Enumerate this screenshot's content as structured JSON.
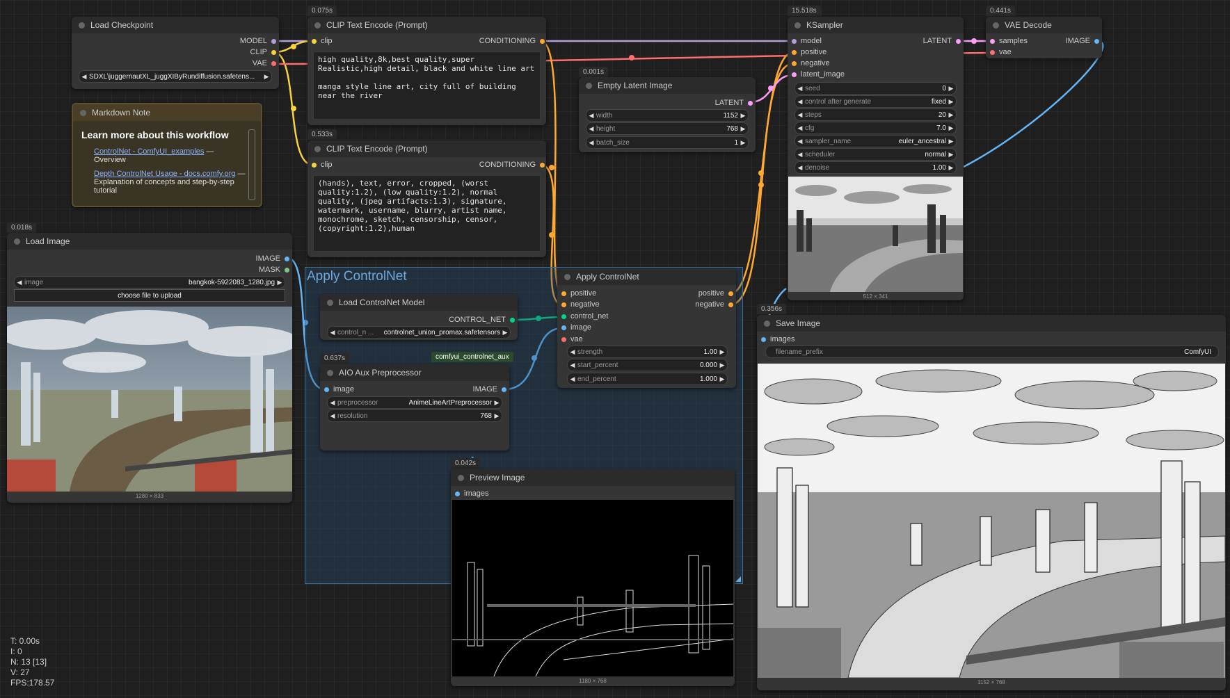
{
  "colors": {
    "model": "#b39ddb",
    "clip": "#f8d33f",
    "vae": "#ff6e6e",
    "conditioning": "#ffa931",
    "latent": "#ff9cf9",
    "image": "#64b5f6",
    "mask": "#81c784",
    "control_net": "#00d78d"
  },
  "load_checkpoint": {
    "title": "Load Checkpoint",
    "outputs": [
      "MODEL",
      "CLIP",
      "VAE"
    ],
    "ckpt_value": "SDXL\\juggernautXL_juggXIByRundiffusion.safetens..."
  },
  "markdown_note": {
    "title": "Markdown Note",
    "heading": "Learn more about this workflow",
    "item1_link": "ControlNet - ComfyUI_examples",
    "item1_rest": " — Overview",
    "item2_link": "Depth ControlNet Usage - docs.comfy.org",
    "item2_rest": " — Explanation of concepts and step-by-step tutorial"
  },
  "clip_pos": {
    "timing": "0.075s",
    "title": "CLIP Text Encode (Prompt)",
    "input": "clip",
    "output": "CONDITIONING",
    "text": "high quality,8k,best quality,super Realistic,high detail, black and white line art\n\nmanga style line art, city full of building near the river"
  },
  "clip_neg": {
    "timing": "0.533s",
    "title": "CLIP Text Encode (Prompt)",
    "input": "clip",
    "output": "CONDITIONING",
    "text": "(hands), text, error, cropped, (worst quality:1.2), (low quality:1.2), normal quality, (jpeg artifacts:1.3), signature, watermark, username, blurry, artist name, monochrome, sketch, censorship, censor, (copyright:1.2),human"
  },
  "empty_latent": {
    "timing": "0.001s",
    "title": "Empty Latent Image",
    "output": "LATENT",
    "widgets": [
      {
        "label": "width",
        "value": "1152"
      },
      {
        "label": "height",
        "value": "768"
      },
      {
        "label": "batch_size",
        "value": "1"
      }
    ]
  },
  "ksampler": {
    "timing": "15.518s",
    "title": "KSampler",
    "inputs": [
      "model",
      "positive",
      "negative",
      "latent_image"
    ],
    "output": "LATENT",
    "widgets": [
      {
        "label": "seed",
        "value": "0"
      },
      {
        "label": "control after generate",
        "value": "fixed"
      },
      {
        "label": "steps",
        "value": "20"
      },
      {
        "label": "cfg",
        "value": "7.0"
      },
      {
        "label": "sampler_name",
        "value": "euler_ancestral"
      },
      {
        "label": "scheduler",
        "value": "normal"
      },
      {
        "label": "denoise",
        "value": "1.00"
      }
    ],
    "preview_size": "512 × 341"
  },
  "vae_decode": {
    "timing": "0.441s",
    "title": "VAE Decode",
    "inputs": [
      "samples",
      "vae"
    ],
    "output": "IMAGE"
  },
  "load_image": {
    "timing": "0.018s",
    "title": "Load Image",
    "outputs": [
      "IMAGE",
      "MASK"
    ],
    "image_label": "image",
    "image_value": "bangkok-5922083_1280.jpg",
    "upload_label": "choose file to upload",
    "size": "1280 × 833"
  },
  "group": {
    "title": "Apply ControlNet"
  },
  "load_controlnet": {
    "title": "Load ControlNet Model",
    "output": "CONTROL_NET",
    "widget_label": "control_n ...",
    "widget_value": "controlnet_union_promax.safetensors"
  },
  "aio_badge": "comfyui_controlnet_aux",
  "aio": {
    "timing": "0.637s",
    "title": "AIO Aux Preprocessor",
    "input": "image",
    "output": "IMAGE",
    "widgets": [
      {
        "label": "preprocessor",
        "value": "AnimeLineArtPreprocessor"
      },
      {
        "label": "resolution",
        "value": "768"
      }
    ]
  },
  "apply_controlnet": {
    "title": "Apply ControlNet",
    "inputs": [
      "positive",
      "negative",
      "control_net",
      "image",
      "vae"
    ],
    "outputs": [
      "positive",
      "negative"
    ],
    "widgets": [
      {
        "label": "strength",
        "value": "1.00"
      },
      {
        "label": "start_percent",
        "value": "0.000"
      },
      {
        "label": "end_percent",
        "value": "1.000"
      }
    ]
  },
  "preview_image": {
    "timing": "0.042s",
    "title": "Preview Image",
    "input": "images",
    "size": "1180 × 768"
  },
  "save_image": {
    "timing": "0.356s",
    "title": "Save Image",
    "input": "images",
    "prefix_label": "filename_prefix",
    "prefix_value": "ComfyUI",
    "size": "1152 × 768"
  },
  "stats": {
    "t": "T: 0.00s",
    "i": "I: 0",
    "n": "N: 13 [13]",
    "v": "V: 27",
    "fps": "FPS:178.57"
  }
}
